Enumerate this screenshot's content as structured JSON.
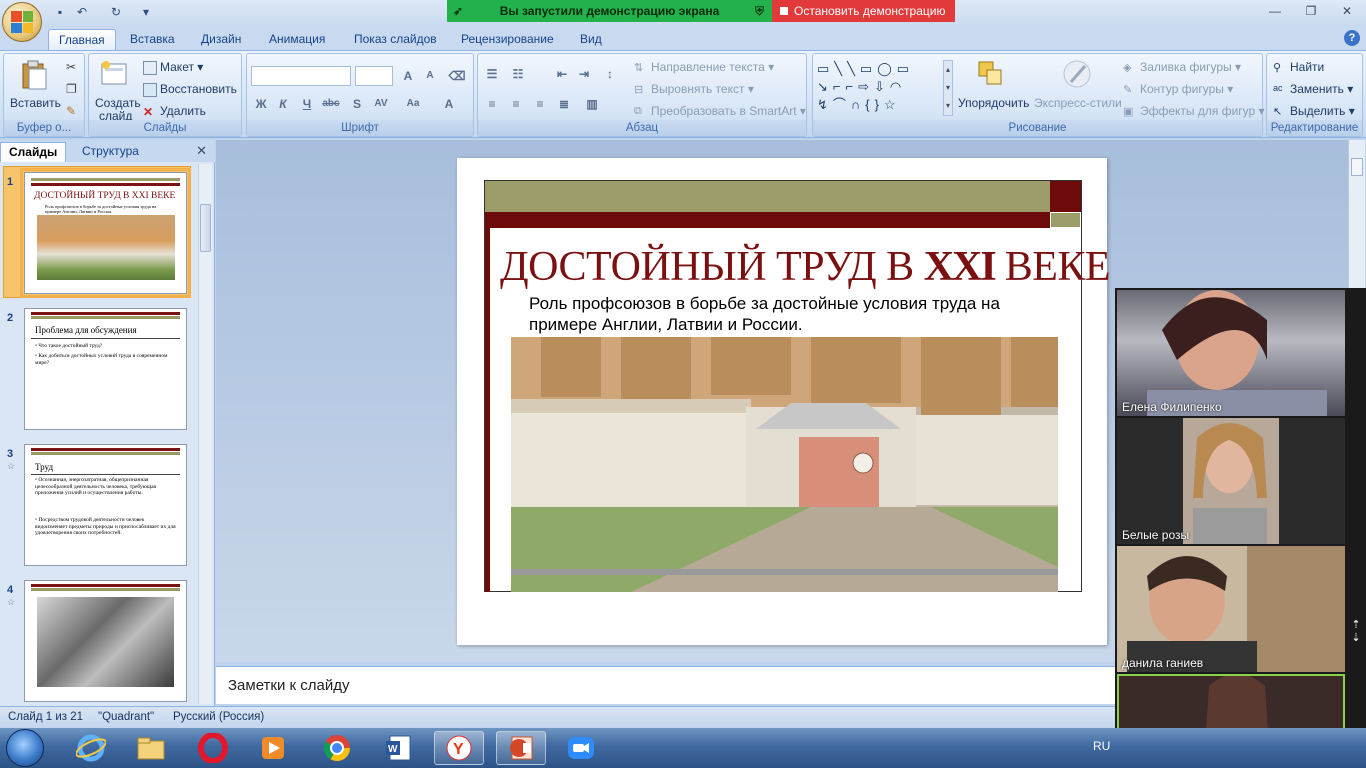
{
  "share": {
    "green_label": "Вы запустили демонстрацию экрана",
    "red_label": "Остановить демонстрацию"
  },
  "tabs": [
    "Главная",
    "Вставка",
    "Дизайн",
    "Анимация",
    "Показ слайдов",
    "Рецензирование",
    "Вид"
  ],
  "ribbon": {
    "clipboard": {
      "paste": "Вставить",
      "label": "Буфер о..."
    },
    "slides": {
      "create1": "Создать",
      "create2": "слайд",
      "layout": "Макет",
      "reset": "Восстановить",
      "delete": "Удалить",
      "label": "Слайды"
    },
    "font": {
      "label": "Шрифт"
    },
    "paragraph": {
      "text_dir": "Направление текста",
      "align_text": "Выровнять текст",
      "smartart": "Преобразовать в SmartArt",
      "label": "Абзац"
    },
    "drawing": {
      "arrange": "Упорядочить",
      "quick_styles": "Экспресс-стили",
      "fill": "Заливка фигуры",
      "outline": "Контур фигуры",
      "effects": "Эффекты для фигур",
      "label": "Рисование"
    },
    "editing": {
      "find": "Найти",
      "replace": "Заменить",
      "select": "Выделить",
      "label": "Редактирование"
    }
  },
  "left_pane": {
    "tab_slides": "Слайды",
    "tab_outline": "Структура",
    "thumbs": [
      {
        "num": "1",
        "title": "ДОСТОЙНЫЙ ТРУД В XXI ВЕКЕ",
        "text": "Роль профсоюзов в борьбе за достойные условия труда на примере Англии, Латвии и России."
      },
      {
        "num": "2",
        "title": "Проблема для обсуждения",
        "b1": "Что такое достойный труд?",
        "b2": "Как добиться достойных условий труда в современном мире?"
      },
      {
        "num": "3",
        "title": "Труд",
        "b1": "Осознанная, энергозатратная, общепризнанная целесообразной деятельность человека, требующая приложения усилий и осуществления работы.",
        "b2": "Посредством трудовой деятельности человек видоизменяет предметы природы и приспосабливает их для удовлетворения своих потребностей."
      },
      {
        "num": "4"
      }
    ]
  },
  "slide": {
    "title_a": "ДОСТОЙНЫЙ ТРУД В ",
    "title_b": "XXI",
    "title_c": " ВЕКЕ",
    "subtitle": "Роль профсоюзов в борьбе за достойные условия труда на примере Англии, Латвии и России."
  },
  "notes": "Заметки к слайду",
  "status": {
    "slide": "Слайд 1 из 21",
    "theme": "\"Quadrant\"",
    "lang": "Русский (Россия)"
  },
  "video": [
    {
      "name": "Елена Филипенко"
    },
    {
      "name": "Белые розы"
    },
    {
      "name": "данила ганиев"
    },
    {
      "name": ""
    }
  ],
  "tray": {
    "lang": "RU"
  }
}
